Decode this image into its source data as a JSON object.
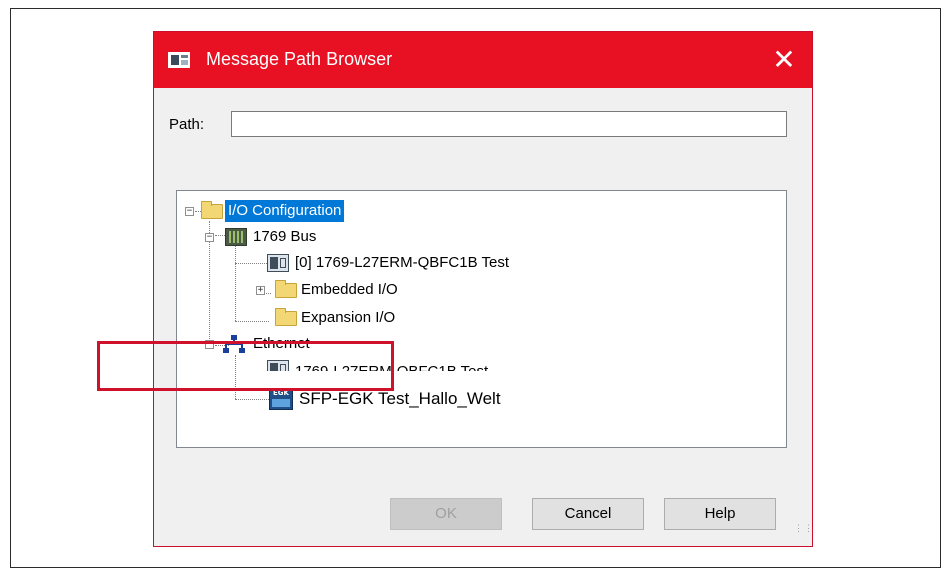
{
  "dialog": {
    "title": "Message Path Browser",
    "close_symbol": "✕",
    "path_label": "Path:",
    "path_value": "",
    "buttons": {
      "ok": "OK",
      "cancel": "Cancel",
      "help": "Help"
    }
  },
  "tree": {
    "io_configuration": "I/O Configuration",
    "bus": "1769 Bus",
    "controller": "[0] 1769-L27ERM-QBFC1B Test",
    "embedded_io": "Embedded I/O",
    "expansion_io": "Expansion I/O",
    "ethernet": "Ethernet",
    "controller_ethernet": "1769-L27ERM-QBFC1B Test",
    "sfp_egk": "SFP-EGK Test_Hallo_Welt",
    "egk_icon_text": "EGK"
  },
  "icons": [
    "app-icon",
    "close-icon",
    "folder-icon",
    "rack-icon",
    "module-icon",
    "network-icon",
    "egk-device-icon"
  ],
  "colors": {
    "titlebar": "#e81123",
    "selection": "#0078d7",
    "highlight": "#d0112b"
  }
}
